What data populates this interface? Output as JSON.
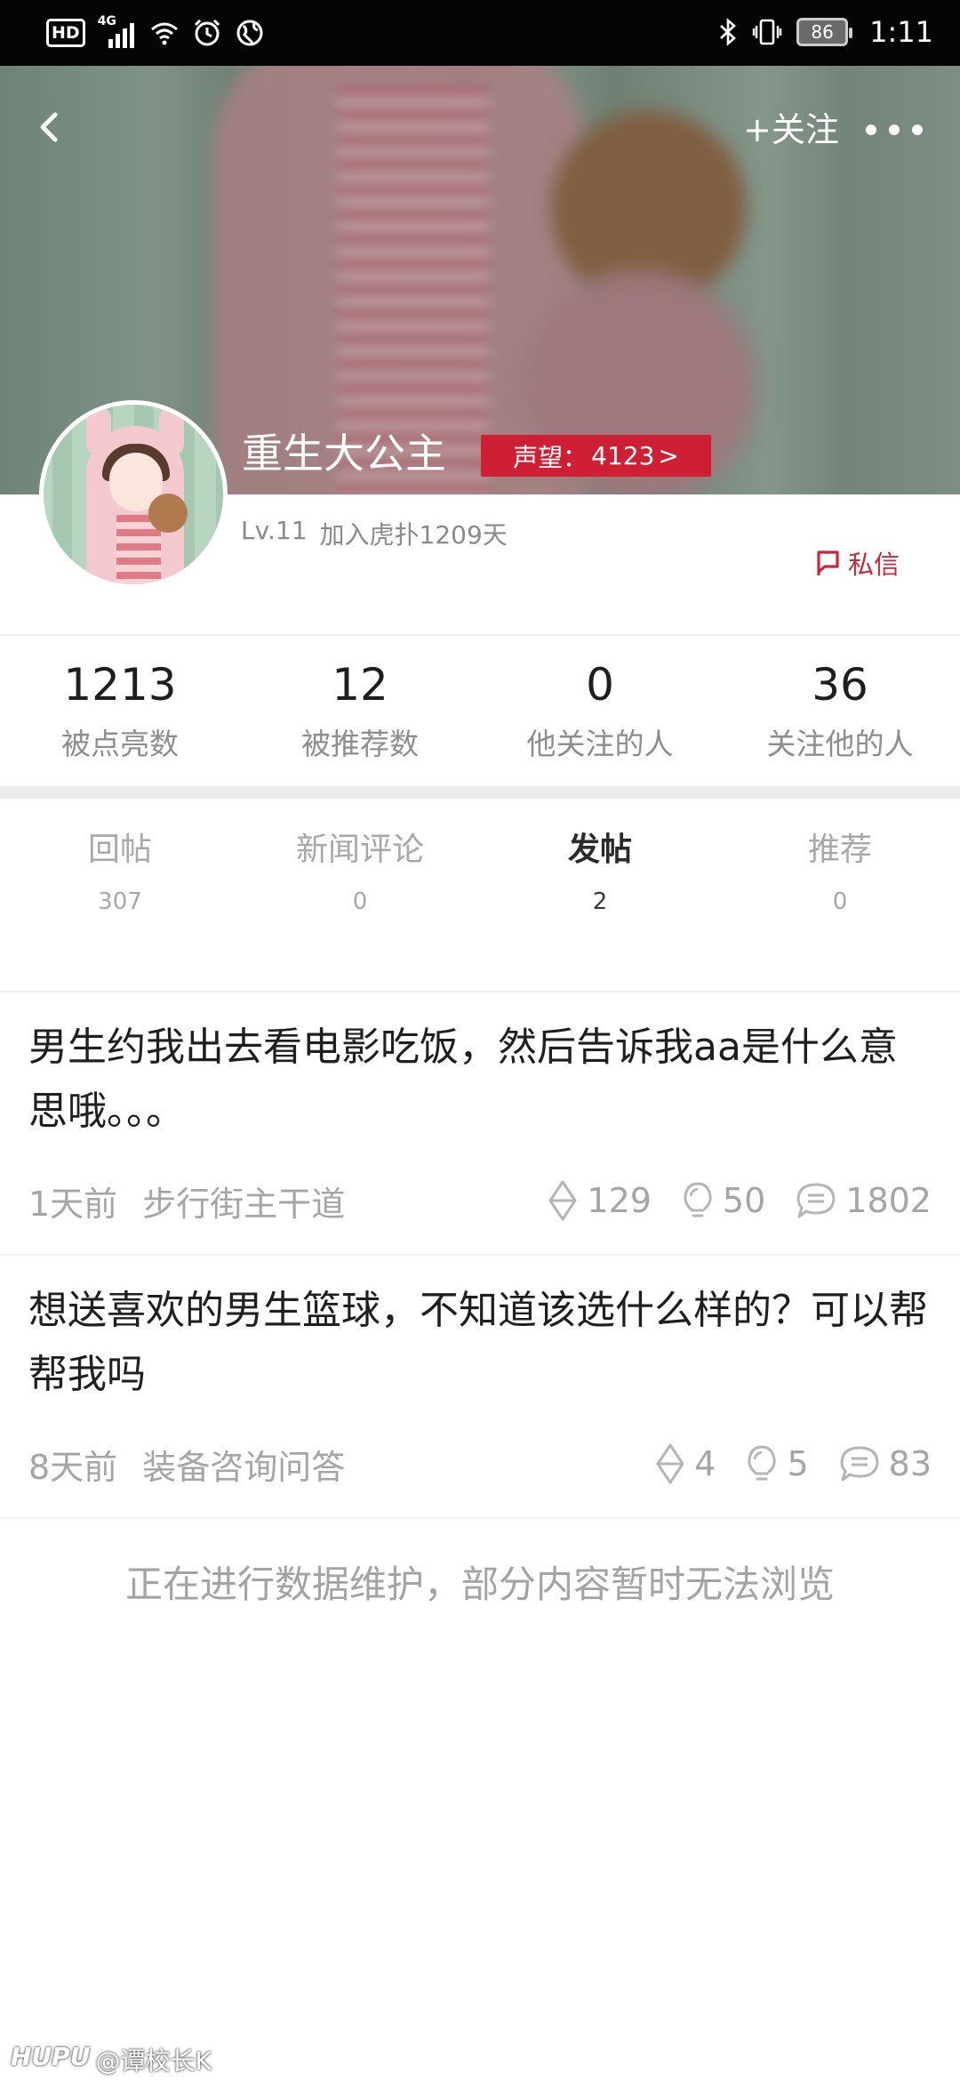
{
  "status_bar": {
    "hd": "HD",
    "network": "4G",
    "battery": "86",
    "time": "1:11"
  },
  "header": {
    "follow_label": "+关注"
  },
  "profile": {
    "username": "重生大公主",
    "reputation_label": "声望：",
    "reputation_value": "4123",
    "reputation_arrow": ">",
    "level": "Lv.11",
    "joined": "加入虎扑1209天",
    "pm_label": "私信"
  },
  "stats": [
    {
      "value": "1213",
      "label": "被点亮数"
    },
    {
      "value": "12",
      "label": "被推荐数"
    },
    {
      "value": "0",
      "label": "他关注的人"
    },
    {
      "value": "36",
      "label": "关注他的人"
    }
  ],
  "tabs": [
    {
      "label": "回帖",
      "count": "307",
      "active": false
    },
    {
      "label": "新闻评论",
      "count": "0",
      "active": false
    },
    {
      "label": "发帖",
      "count": "2",
      "active": true
    },
    {
      "label": "推荐",
      "count": "0",
      "active": false
    }
  ],
  "posts": [
    {
      "title": "男生约我出去看电影吃饭，然后告诉我aa是什么意思哦。。。",
      "time": "1天前",
      "board": "步行街主干道",
      "recommends": "129",
      "lights": "50",
      "replies": "1802"
    },
    {
      "title": "想送喜欢的男生篮球，不知道该选什么样的？可以帮帮我吗",
      "time": "8天前",
      "board": "装备咨询问答",
      "recommends": "4",
      "lights": "5",
      "replies": "83"
    }
  ],
  "notice": "正在进行数据维护，部分内容暂时无法浏览",
  "watermark": {
    "brand": "HUPU",
    "handle": "@谭校长K"
  },
  "colors": {
    "accent_red": "#cf1f34",
    "pm_red": "#c8283b",
    "muted_text": "#a5a5a5"
  },
  "icons": [
    "back-arrow-icon",
    "more-dots-icon",
    "message-flag-icon",
    "recommend-icon",
    "light-bulb-icon",
    "reply-bubble-icon"
  ]
}
